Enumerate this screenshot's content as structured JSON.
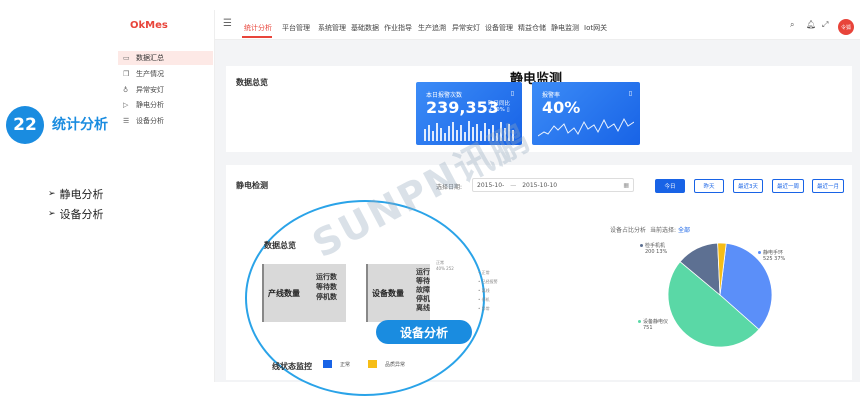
{
  "promo": {
    "number": "22",
    "title": "统计分析",
    "bullets": [
      "静电分析",
      "设备分析"
    ]
  },
  "app": {
    "logo": "OkMes",
    "sidebar": [
      "数据汇总",
      "生产情况",
      "异常安灯",
      "静电分析",
      "设备分析"
    ],
    "nav": [
      "统计分析",
      "平台管理",
      "系统管理",
      "基础数据",
      "作业指导",
      "生产追溯",
      "异常安灯",
      "设备管理",
      "精益仓储",
      "静电监测",
      "Iot网关"
    ],
    "avatar": "令狐",
    "screen_title": "静电监测"
  },
  "overview": {
    "title": "数据总览",
    "alarm_card": {
      "label": "本日报警次数",
      "value": "239,353",
      "compare_label": "昨日同比",
      "compare_value": "+30% ▯"
    },
    "rate_card": {
      "label": "报警率",
      "value": "40%"
    }
  },
  "monitor": {
    "title": "静电检测",
    "date_label": "选择日期:",
    "date_start": "2015-10-",
    "date_end": "2015-10-10",
    "buttons": [
      "今日",
      "昨天",
      "最近3天",
      "最近一周",
      "最近一月"
    ],
    "share_title": "设备占比分析",
    "share_filter_label": "当前选择:",
    "share_filter_value": "全部",
    "pie_labels": [
      {
        "name": "检手机机",
        "detail": "200   13%"
      },
      {
        "name": "静电手环",
        "detail": "525   37%"
      },
      {
        "name": "设备静电仪",
        "detail": "751"
      }
    ]
  },
  "magnifier": {
    "title": "数据总览",
    "box1_title": "产线数量",
    "box1_lines": [
      "运行数",
      "等待数",
      "停机数"
    ],
    "box2_title": "设备数量",
    "box2_lines": [
      "运行",
      "等待",
      "故障",
      "停机",
      "离线"
    ],
    "top_label": "正常",
    "top_value": "40%   252",
    "legend": [
      "正常",
      "已经报警",
      "离线",
      "停机",
      "异常"
    ],
    "callout": "设备分析",
    "bottom_title": "线状态监控",
    "bottom_legend": [
      "正常",
      "品质异常"
    ]
  },
  "colors": {
    "brand_red": "#e8443a",
    "brand_blue": "#1863e6",
    "promo_blue": "#1a8ce0",
    "pie": [
      "#5b8ff9",
      "#5ad8a6",
      "#5d7092",
      "#f6bd16"
    ]
  },
  "chart_data": {
    "type": "pie",
    "slices": [
      {
        "name": "静电手环",
        "value": 525
      },
      {
        "name": "设备静电仪",
        "value": 751
      },
      {
        "name": "检手机机",
        "value": 200
      },
      {
        "name": "",
        "value": 40
      }
    ]
  }
}
